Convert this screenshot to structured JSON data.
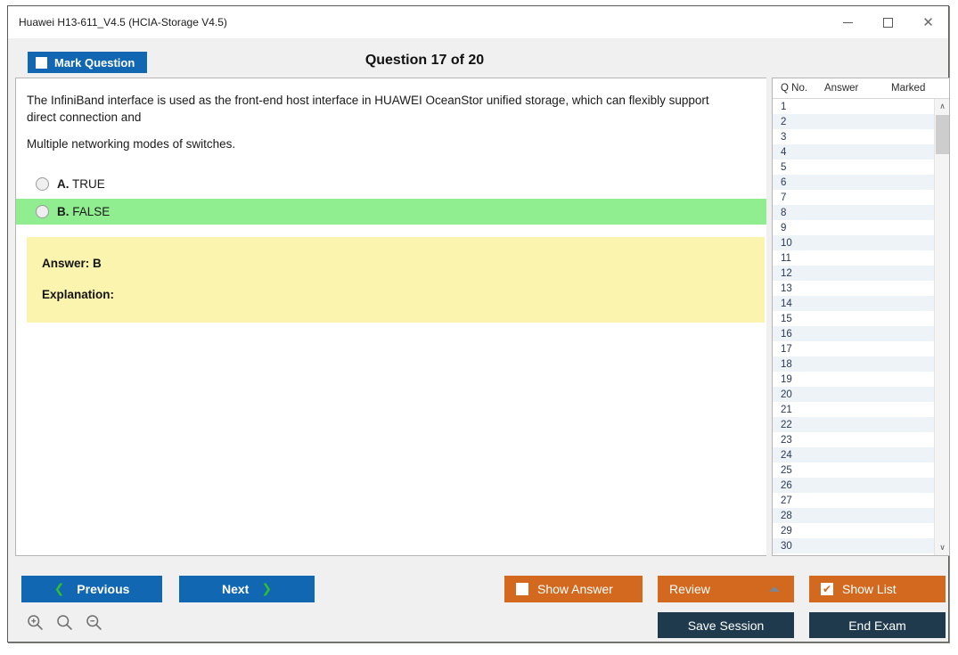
{
  "window": {
    "title": "Huawei H13-611_V4.5 (HCIA-Storage V4.5)",
    "minimize_label": "—",
    "maximize_label": "",
    "close_label": "✕"
  },
  "header": {
    "mark_question_label": "Mark Question",
    "question_counter": "Question 17 of 20"
  },
  "question": {
    "paragraph1": "The InfiniBand interface is used as the front-end host interface in HUAWEI OceanStor unified storage, which can flexibly support direct connection and",
    "paragraph2": "Multiple networking modes of switches.",
    "options": [
      {
        "letter": "A.",
        "text": "TRUE",
        "selected": false,
        "highlighted": false
      },
      {
        "letter": "B.",
        "text": "FALSE",
        "selected": false,
        "highlighted": true
      }
    ]
  },
  "answer_panel": {
    "answer_label": "Answer: B",
    "explanation_label": "Explanation:",
    "background_color": "#fbf4ae"
  },
  "question_list": {
    "columns": [
      "Q No.",
      "Answer",
      "Marked"
    ],
    "rows": [
      {
        "no": "1",
        "answer": "",
        "marked": ""
      },
      {
        "no": "2",
        "answer": "",
        "marked": ""
      },
      {
        "no": "3",
        "answer": "",
        "marked": ""
      },
      {
        "no": "4",
        "answer": "",
        "marked": ""
      },
      {
        "no": "5",
        "answer": "",
        "marked": ""
      },
      {
        "no": "6",
        "answer": "",
        "marked": ""
      },
      {
        "no": "7",
        "answer": "",
        "marked": ""
      },
      {
        "no": "8",
        "answer": "",
        "marked": ""
      },
      {
        "no": "9",
        "answer": "",
        "marked": ""
      },
      {
        "no": "10",
        "answer": "",
        "marked": ""
      },
      {
        "no": "11",
        "answer": "",
        "marked": ""
      },
      {
        "no": "12",
        "answer": "",
        "marked": ""
      },
      {
        "no": "13",
        "answer": "",
        "marked": ""
      },
      {
        "no": "14",
        "answer": "",
        "marked": ""
      },
      {
        "no": "15",
        "answer": "",
        "marked": ""
      },
      {
        "no": "16",
        "answer": "",
        "marked": ""
      },
      {
        "no": "17",
        "answer": "",
        "marked": ""
      },
      {
        "no": "18",
        "answer": "",
        "marked": ""
      },
      {
        "no": "19",
        "answer": "",
        "marked": ""
      },
      {
        "no": "20",
        "answer": "",
        "marked": ""
      },
      {
        "no": "21",
        "answer": "",
        "marked": ""
      },
      {
        "no": "22",
        "answer": "",
        "marked": ""
      },
      {
        "no": "23",
        "answer": "",
        "marked": ""
      },
      {
        "no": "24",
        "answer": "",
        "marked": ""
      },
      {
        "no": "25",
        "answer": "",
        "marked": ""
      },
      {
        "no": "26",
        "answer": "",
        "marked": ""
      },
      {
        "no": "27",
        "answer": "",
        "marked": ""
      },
      {
        "no": "28",
        "answer": "",
        "marked": ""
      },
      {
        "no": "29",
        "answer": "",
        "marked": ""
      },
      {
        "no": "30",
        "answer": "",
        "marked": ""
      }
    ],
    "scroll_up_label": "∧",
    "scroll_down_label": "∨"
  },
  "toolbar": {
    "previous_label": "Previous",
    "next_label": "Next",
    "prev_chevron": "❮",
    "next_chevron": "❯",
    "show_answer_label": "Show Answer",
    "show_answer_checked": false,
    "review_label": "Review",
    "show_list_label": "Show List",
    "show_list_checked": true,
    "show_list_check_glyph": "✔",
    "save_session_label": "Save Session",
    "end_exam_label": "End Exam",
    "zoom_in_name": "zoom-in-icon",
    "zoom_reset_name": "zoom-reset-icon",
    "zoom_out_name": "zoom-out-icon"
  },
  "colors": {
    "accent_blue": "#1267b2",
    "accent_orange": "#d2691e",
    "dark_navy": "#1f3a4d",
    "highlight_green": "#90ee90",
    "answer_yellow": "#fbf4ae",
    "chevron_green": "#2fbe2f"
  }
}
